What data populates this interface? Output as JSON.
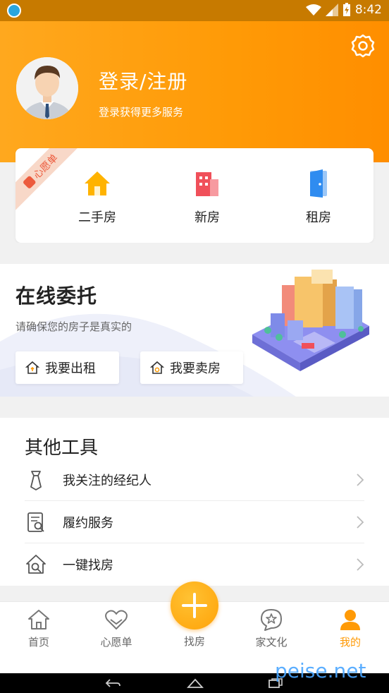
{
  "status_bar": {
    "time": "8:42"
  },
  "header": {
    "login_title": "登录/注册",
    "login_subtitle": "登录获得更多服务",
    "settings_icon": "gear-icon",
    "brand_color": "#ff9a06"
  },
  "wishlist_card": {
    "ribbon": "心愿单",
    "items": [
      {
        "label": "二手房",
        "icon": "house-icon",
        "color": "#ffb300"
      },
      {
        "label": "新房",
        "icon": "building-icon",
        "color": "#f0505a"
      },
      {
        "label": "租房",
        "icon": "door-icon",
        "color": "#2f8cf0"
      }
    ]
  },
  "delegate": {
    "title": "在线委托",
    "subtitle": "请确保您的房子是真实的",
    "rent_button": "我要出租",
    "sell_button": "我要卖房"
  },
  "tools": {
    "title": "其他工具",
    "items": [
      {
        "label": "我关注的经纪人",
        "icon": "tie-icon"
      },
      {
        "label": "履约服务",
        "icon": "contract-search-icon"
      },
      {
        "label": "一键找房",
        "icon": "house-search-icon"
      }
    ]
  },
  "tabbar": {
    "tabs": [
      {
        "label": "首页",
        "icon": "home-icon"
      },
      {
        "label": "心愿单",
        "icon": "heart-icon"
      },
      {
        "label": "找房",
        "icon": "plus-icon"
      },
      {
        "label": "家文化",
        "icon": "star-bubble-icon"
      },
      {
        "label": "我的",
        "icon": "person-icon",
        "active": true
      }
    ]
  },
  "watermark": "peise.net"
}
